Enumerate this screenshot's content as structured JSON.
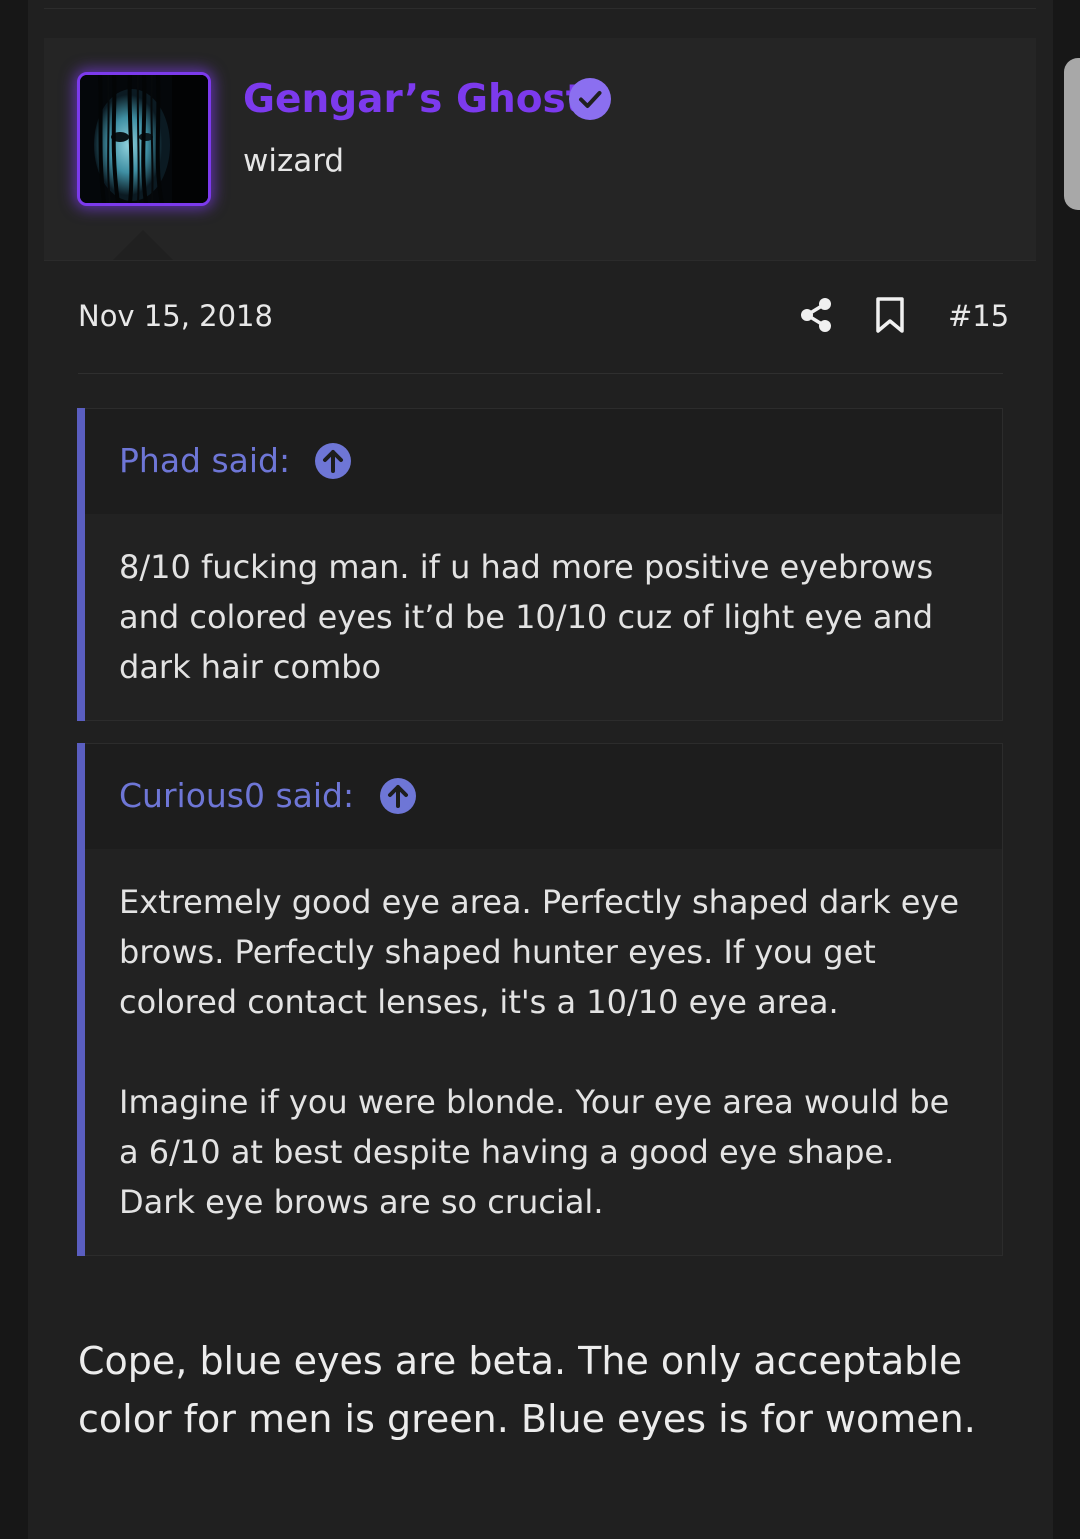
{
  "author": {
    "username": "Gengar’s Ghost",
    "title": "wizard",
    "verified": true,
    "accent_color": "#7c3aed"
  },
  "post": {
    "date": "Nov 15, 2018",
    "number": "#15",
    "actions": [
      "share-icon",
      "bookmark-icon"
    ]
  },
  "quotes": [
    {
      "author": "Phad said:",
      "paragraphs": [
        "8/10 fucking man. if u had more positive eyebrows and colored eyes it’d be 10/10 cuz of light eye and dark hair combo"
      ]
    },
    {
      "author": "Curious0 said:",
      "paragraphs": [
        "Extremely good eye area. Perfectly shaped dark eye brows. Perfectly shaped hunter eyes. If you get colored contact lenses, it's a 10/10 eye area.",
        "Imagine if you were blonde. Your eye area would be a 6/10 at best despite having a good eye shape. Dark eye brows are so crucial."
      ]
    }
  ],
  "body": "Cope, blue eyes are beta. The only acceptable color for men is green. Blue eyes is for women.",
  "colors": {
    "quote_bar": "#5a5ec0",
    "quote_author": "#6e76d6",
    "background": "#202020"
  }
}
